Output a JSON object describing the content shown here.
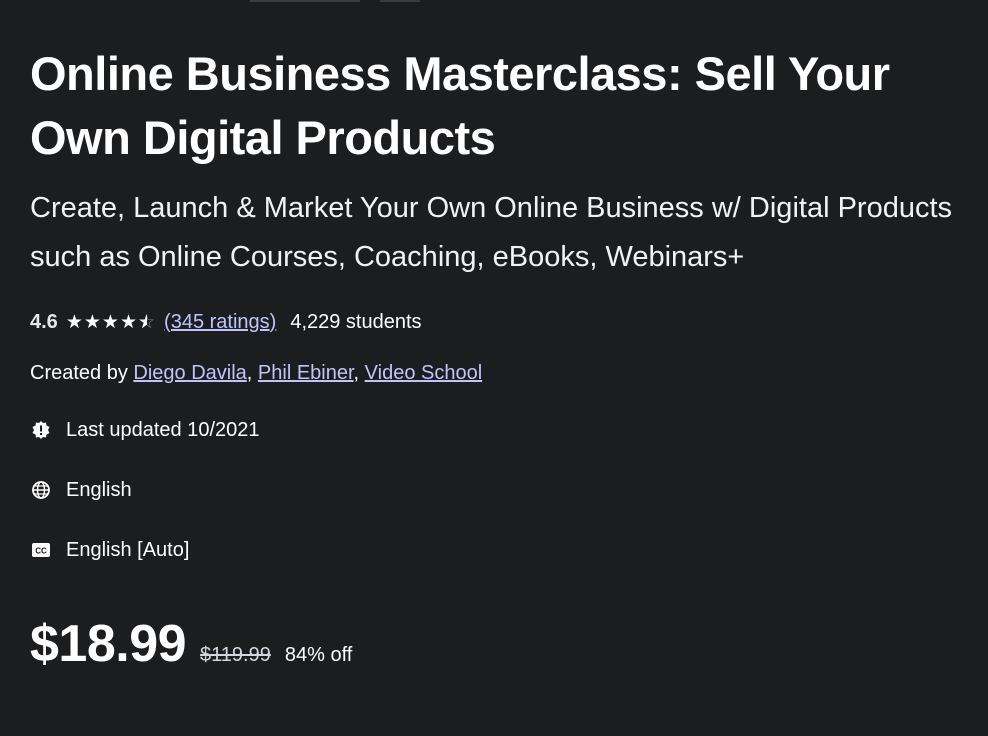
{
  "course": {
    "title": "Online Business Masterclass: Sell Your Own Digital Products",
    "subtitle": "Create, Launch & Market Your Own Online Business w/ Digital Products such as Online Courses, Coaching, eBooks, Webinars+"
  },
  "rating": {
    "value": "4.6",
    "stars": 4.6,
    "ratings_count": "(345 ratings)",
    "students": "4,229 students"
  },
  "created": {
    "prefix": "Created by",
    "authors": [
      "Diego Davila",
      "Phil Ebiner",
      "Video School"
    ]
  },
  "meta": {
    "last_updated": "Last updated 10/2021",
    "language": "English",
    "captions": "English [Auto]"
  },
  "price": {
    "current": "$18.99",
    "original": "$119.99",
    "discount": "84% off"
  },
  "icons": {
    "updated": "alert-badge-icon",
    "language": "globe-icon",
    "captions": "closed-captions-icon"
  },
  "colors": {
    "background": "#1c1d1f",
    "link": "#c0c4fc"
  }
}
